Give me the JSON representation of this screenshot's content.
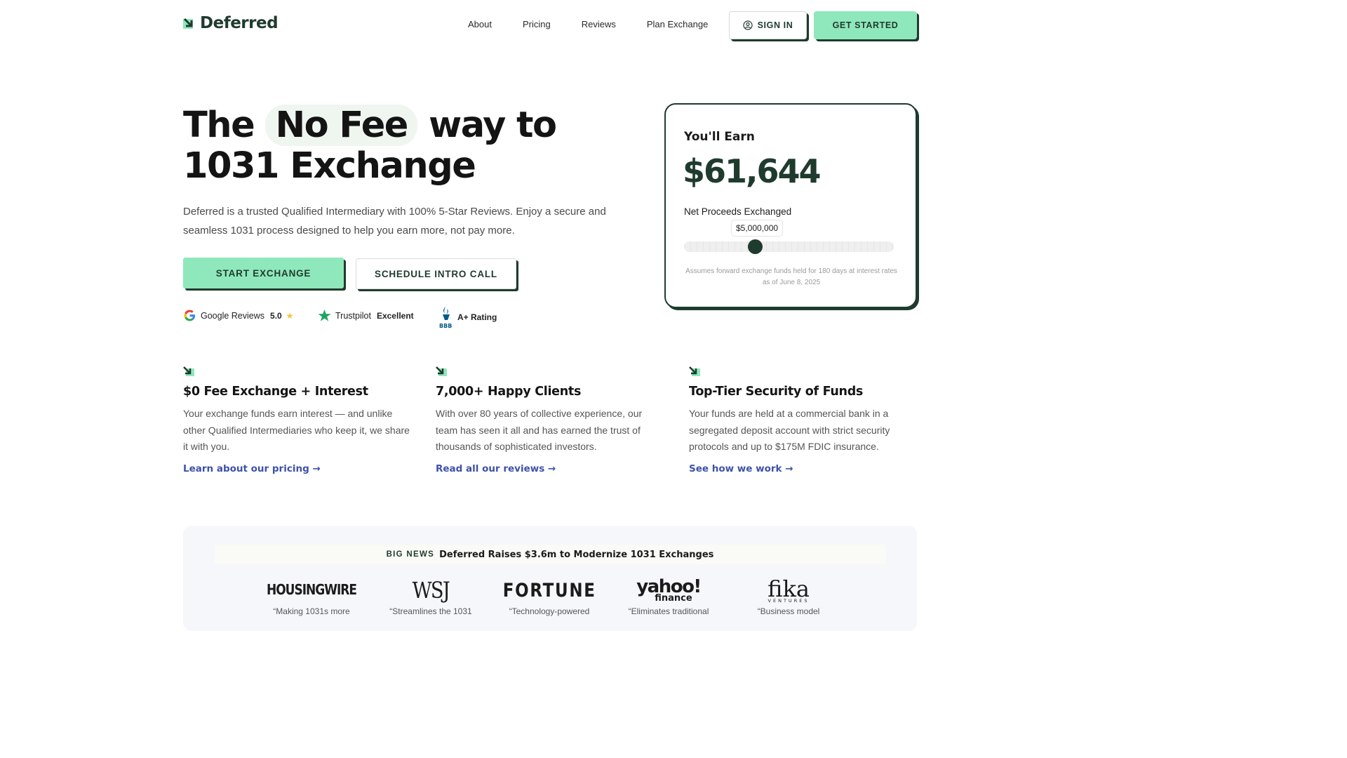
{
  "brand": {
    "name": "Deferred",
    "accent": "#8fe8bb",
    "dark": "#1f3b2d",
    "link": "#3d52a8"
  },
  "nav": {
    "links": [
      "About",
      "Pricing",
      "Reviews",
      "Plan Exchange"
    ],
    "sign_in": "SIGN IN",
    "get_started": "GET STARTED"
  },
  "hero": {
    "title_pre": "The",
    "title_highlight": "No Fee",
    "title_post": "way to",
    "title_line2": "1031 Exchange",
    "description": "Deferred is a trusted Qualified Intermediary with 100% 5-Star Reviews. Enjoy a secure and seamless 1031 process designed to help you earn more, not pay more.",
    "start_button": "START EXCHANGE",
    "schedule_button": "SCHEDULE INTRO CALL"
  },
  "ratings": {
    "google_label": "Google Reviews",
    "google_score": "5.0",
    "trustpilot_label": "Trustpilot",
    "trustpilot_score": "Excellent",
    "bbb_label": "A+ Rating"
  },
  "calculator": {
    "label": "You'll Earn",
    "amount": "$61,644",
    "slider_label": "Net Proceeds Exchanged",
    "slider_value": "$5,000,000",
    "slider_fraction": 0.34,
    "note": "Assumes forward exchange funds held for 180 days at interest rates as of June 8, 2025"
  },
  "features": [
    {
      "title": "$0 Fee Exchange + Interest",
      "text": "Your exchange funds earn interest — and unlike other Qualified Intermediaries who keep it, we share it with you.",
      "link": "Learn about our pricing →"
    },
    {
      "title": "7,000+ Happy Clients",
      "text": "With over 80 years of collective experience, our team has seen it all and has earned the trust of thousands of sophisticated investors.",
      "link": "Read all our reviews →"
    },
    {
      "title": "Top-Tier Security of Funds",
      "text": "Your funds are held at a commercial bank in a segregated deposit account with strict security protocols and up to $175M FDIC insurance.",
      "link": "See how we work →"
    }
  ],
  "news": {
    "tag": "BIG NEWS",
    "headline": "Deferred Raises $3.6m to Modernize 1031 Exchanges",
    "press": [
      {
        "logo": "HOUSINGWIRE",
        "quote": "“Making 1031s more"
      },
      {
        "logo": "WSJ",
        "quote": "“Streamlines the 1031"
      },
      {
        "logo": "FORTUNE",
        "quote": "“Technology-powered"
      },
      {
        "logo": "yahoo!",
        "logo_sub": "finance",
        "quote": "“Eliminates traditional"
      },
      {
        "logo": "fika",
        "logo_sub": "VENTURES",
        "quote": "“Business model"
      }
    ]
  }
}
